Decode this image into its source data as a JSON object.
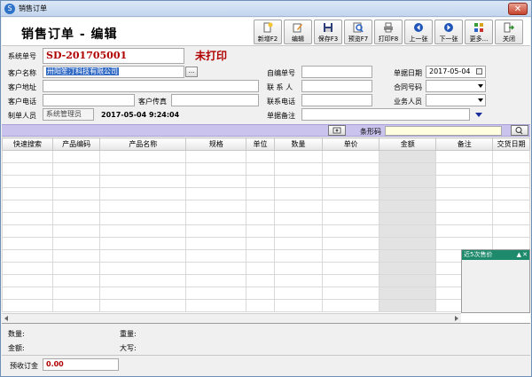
{
  "window": {
    "title": "销售订单",
    "icon": "app-logo-icon"
  },
  "header": {
    "title": "销售订单 - 编辑"
  },
  "toolbar": [
    {
      "label": "新增F2",
      "icon": "new-icon"
    },
    {
      "label": "编辑",
      "icon": "edit-icon"
    },
    {
      "label": "保存F3",
      "icon": "save-icon"
    },
    {
      "label": "预览F7",
      "icon": "preview-icon"
    },
    {
      "label": "打印F8",
      "icon": "print-icon"
    },
    {
      "label": "上一张",
      "icon": "prev-icon"
    },
    {
      "label": "下一张",
      "icon": "next-icon"
    },
    {
      "label": "更多...",
      "icon": "more-icon"
    },
    {
      "label": "关闭",
      "icon": "exit-icon"
    }
  ],
  "form": {
    "order_no_label": "系统单号",
    "order_no": "SD-201705001",
    "print_status": "未打印",
    "customer_name_label": "客户名称",
    "customer_name": "卅阳笙汀科技有限公司",
    "customer_address_label": "客户地址",
    "customer_phone_label": "客户电话",
    "customer_fax_label": "客户传真",
    "creator_label": "制单人员",
    "creator": "系统管理员",
    "created_at": "2017-05-04 9:24:04",
    "custom_no_label": "自编单号",
    "contact_label": "联 系 人",
    "contact_phone_label": "联系电话",
    "remark_label": "单据备注",
    "doc_date_label": "单据日期",
    "doc_date": "2017-05-04",
    "contract_no_label": "合同号码",
    "salesperson_label": "业务人员",
    "dots": "..."
  },
  "barcode": {
    "label": "条形码"
  },
  "grid": {
    "columns": [
      "快速搜索",
      "产品编码",
      "产品名称",
      "规格",
      "单位",
      "数量",
      "单价",
      "金额",
      "备注",
      "交货日期"
    ]
  },
  "history": {
    "title": "近5次售价",
    "pin": "▲",
    "close": "✕"
  },
  "summary": {
    "quantity_label": "数量:",
    "weight_label": "重量:",
    "amount_label": "金额:",
    "uppercase_label": "大写:",
    "deposit_label": "预收订金",
    "deposit_value": "0.00"
  },
  "colors": {
    "accent": "#b00000",
    "barcode_bar": "#c9c3ee",
    "history_head": "#1d8a6b"
  }
}
